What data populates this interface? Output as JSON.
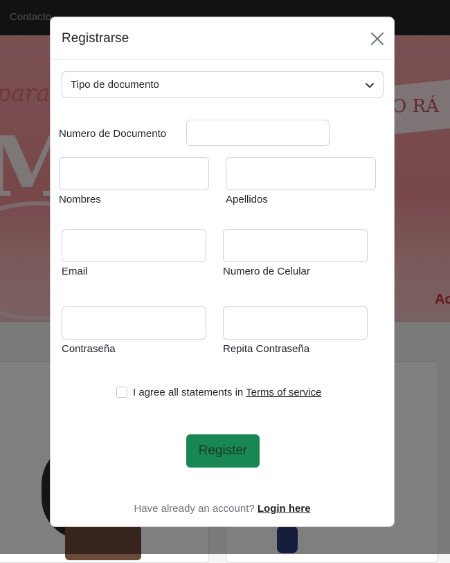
{
  "background": {
    "nav_link": "Contacto",
    "banner_script": "para",
    "banner_big": "MÁ",
    "banner_ribbon": "O RÁ",
    "banner_corner": "Ac"
  },
  "modal": {
    "title": "Registrarse",
    "close_icon": "close-icon",
    "document_type": {
      "selected": "Tipo de documento",
      "icon": "chevron-down-icon"
    },
    "fields": {
      "document_number_label": "Numero de Documento",
      "first_names_label": "Nombres",
      "last_names_label": "Apellidos",
      "email_label": "Email",
      "phone_label": "Numero de Celular",
      "password_label": "Contraseña",
      "repeat_password_label": "Repita Contraseña"
    },
    "terms": {
      "text": "I agree all statements in ",
      "link": "Terms of service"
    },
    "register_label": "Register",
    "login": {
      "text": "Have already an account? ",
      "link": "Login here"
    }
  },
  "colors": {
    "primary_button": "#198754",
    "banner_pink": "#ee8f93",
    "navbar": "#212529"
  }
}
